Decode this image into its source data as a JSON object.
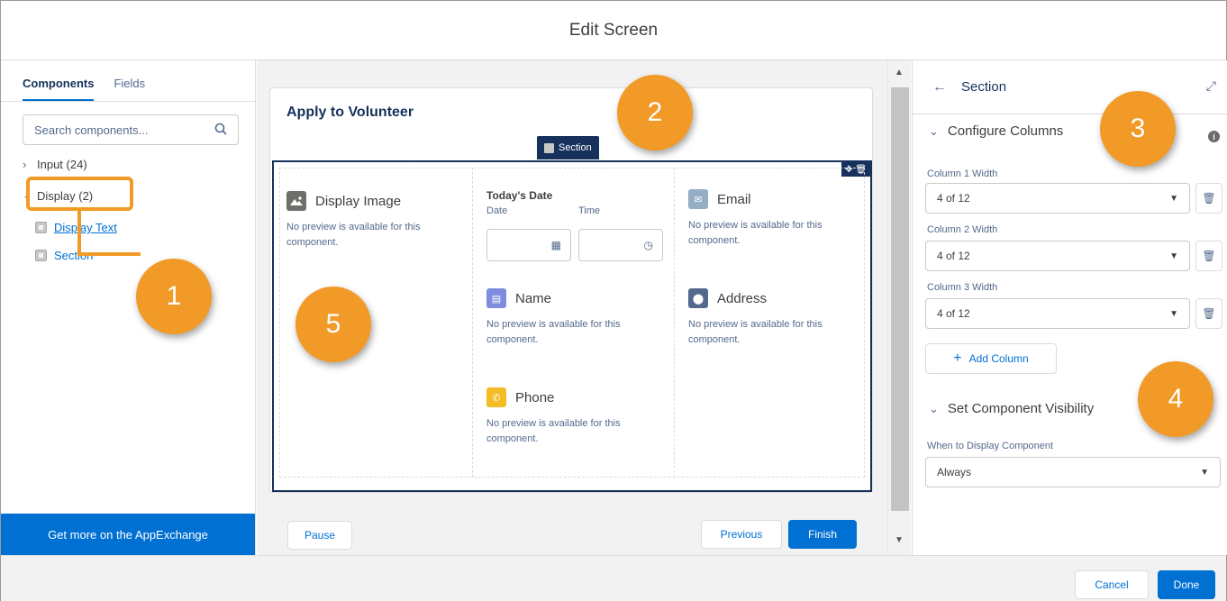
{
  "window": {
    "title": "Edit Screen"
  },
  "left_panel": {
    "tabs": [
      {
        "label": "Components"
      },
      {
        "label": "Fields"
      }
    ],
    "search": {
      "placeholder": "Search components..."
    },
    "groups": [
      {
        "label": "Input (24)"
      },
      {
        "label": "Display (2)"
      }
    ],
    "items": [
      {
        "label": "Display Text"
      },
      {
        "label": "Section"
      }
    ],
    "appexchange_label": "Get more on the AppExchange"
  },
  "canvas": {
    "card_title": "Apply to Volunteer",
    "section_tag": "Section",
    "columns": {
      "col1": {
        "display_image": {
          "title": "Display Image",
          "note": "No preview is available for this component."
        }
      },
      "col2": {
        "date_block": {
          "label": "Today's Date",
          "date_label": "Date",
          "time_label": "Time"
        },
        "name": {
          "title": "Name",
          "note": "No preview is available for this component."
        },
        "phone": {
          "title": "Phone",
          "note": "No preview is available for this component."
        }
      },
      "col3": {
        "email": {
          "title": "Email",
          "note": "No preview is available for this component."
        },
        "address": {
          "title": "Address",
          "note": "No preview is available for this component."
        }
      }
    },
    "footer": {
      "pause": "Pause",
      "previous": "Previous",
      "finish": "Finish"
    }
  },
  "right_panel": {
    "title": "Section",
    "configure_columns": {
      "heading": "Configure Columns",
      "fields": [
        {
          "label": "Column 1 Width",
          "value": "4 of 12"
        },
        {
          "label": "Column 2 Width",
          "value": "4 of 12"
        },
        {
          "label": "Column 3 Width",
          "value": "4 of 12"
        }
      ],
      "add_column": "Add Column"
    },
    "visibility": {
      "heading": "Set Component Visibility",
      "field_label": "When to Display Component",
      "value": "Always"
    }
  },
  "bottom": {
    "cancel": "Cancel",
    "done": "Done"
  },
  "callouts": [
    "1",
    "2",
    "3",
    "4",
    "5"
  ],
  "colors": {
    "accent": "#0070d2",
    "callout": "#f29a27",
    "section_border": "#16325c"
  }
}
